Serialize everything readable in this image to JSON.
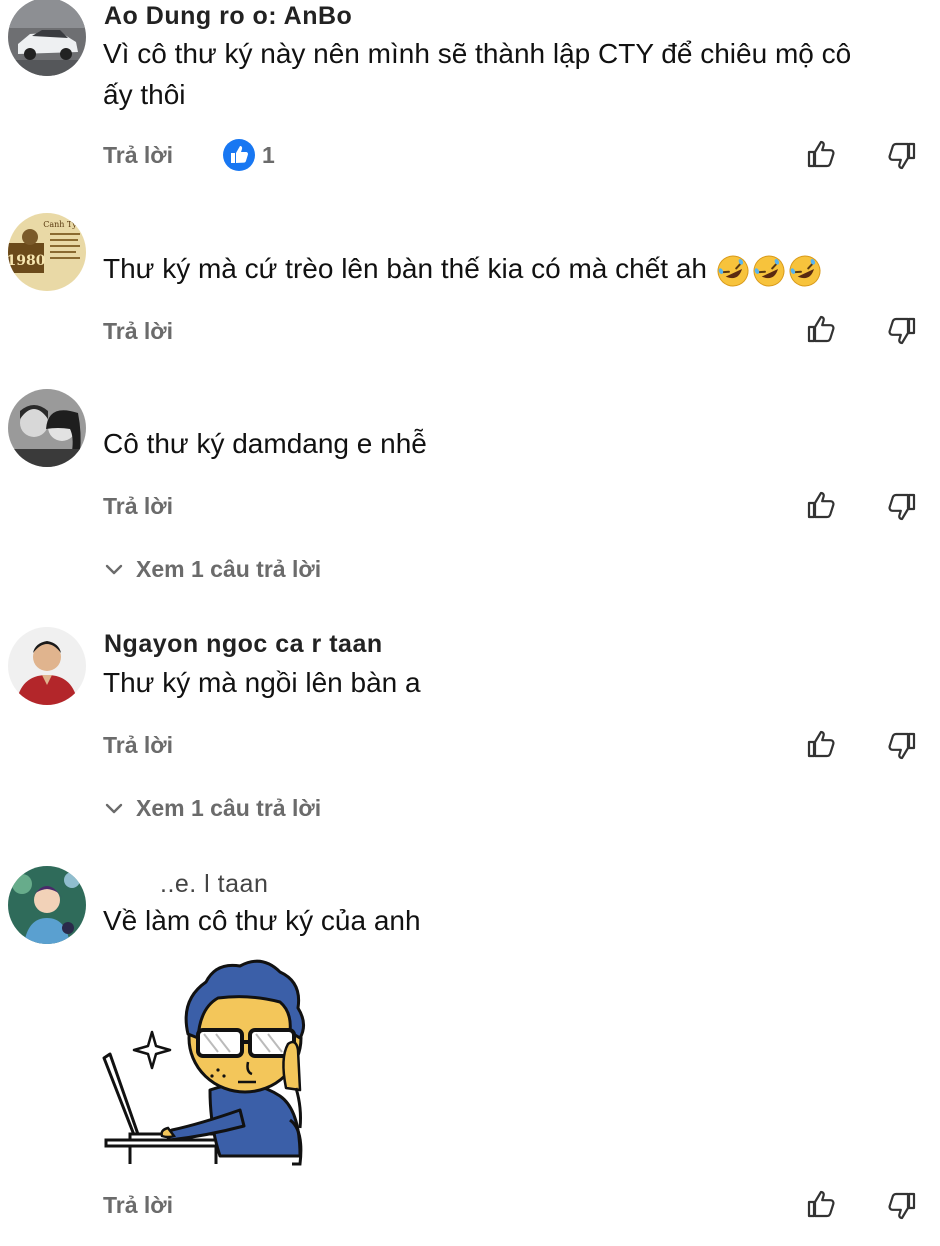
{
  "comments": [
    {
      "author": "Ao Dung ro o: AnBo",
      "text_lines": [
        "Vì cô thư ký này nên mình sẽ thành lập CTY để chiêu mộ cô",
        "ấy thôi"
      ],
      "reply_label": "Trả lời",
      "like_count": "1",
      "avatar_icon": "car-photo-avatar"
    },
    {
      "author": "",
      "text": "Thư ký mà cứ trèo lên bàn thế kia có mà chết ah",
      "emojis": [
        "rolling-on-floor-laughing-emoji",
        "rolling-on-floor-laughing-emoji",
        "rolling-on-floor-laughing-emoji"
      ],
      "reply_label": "Trả lời",
      "avatar_icon": "canh-ty-1980-avatar"
    },
    {
      "author": "",
      "text": "Cô thư ký damdang e nhễ",
      "reply_label": "Trả lời",
      "view_replies": "Xem 1 câu trả lời",
      "avatar_icon": "couple-photo-avatar"
    },
    {
      "author": "Ngayon ngoc ca  r taan",
      "text": "Thư ký mà ngồi lên bàn a",
      "reply_label": "Trả lời",
      "view_replies": "Xem 1 câu trả lời",
      "avatar_icon": "man-red-shirt-avatar"
    },
    {
      "author": "..e.  l taan",
      "text": "Về làm cô thư ký của anh",
      "reply_label": "Trả lời",
      "sticker": "blue-hair-guy-typing-laptop-sticker",
      "avatar_icon": "anime-boy-avatar"
    }
  ],
  "colors": {
    "text": "#111111",
    "muted": "#6b6b6b",
    "like_blue": "#1877f2",
    "icon": "#333333"
  }
}
